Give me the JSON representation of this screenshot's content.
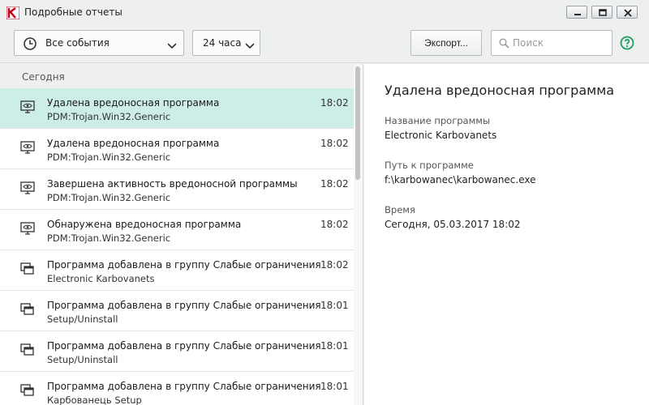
{
  "window": {
    "title": "Подробные отчеты",
    "accent_color": "#c4001a"
  },
  "toolbar": {
    "event_filter": "Все события",
    "period_filter": "24 часа",
    "export_label": "Экспорт...",
    "search_placeholder": "Поиск",
    "help_color": "#1f9e62"
  },
  "group": {
    "label": "Сегодня"
  },
  "events": [
    {
      "icon": "monitor-eye-icon",
      "title": "Удалена вредоносная программа",
      "subtitle": "PDM:Trojan.Win32.Generic",
      "time": "18:02",
      "selected": true
    },
    {
      "icon": "monitor-eye-icon",
      "title": "Удалена вредоносная программа",
      "subtitle": "PDM:Trojan.Win32.Generic",
      "time": "18:02"
    },
    {
      "icon": "monitor-eye-icon",
      "title": "Завершена активность вредоносной программы",
      "subtitle": "PDM:Trojan.Win32.Generic",
      "time": "18:02"
    },
    {
      "icon": "monitor-eye-icon",
      "title": "Обнаружена вредоносная программа",
      "subtitle": "PDM:Trojan.Win32.Generic",
      "time": "18:02"
    },
    {
      "icon": "app-windows-icon",
      "title": "Программа добавлена в группу Слабые ограничения",
      "subtitle": "Electronic Karbovanets",
      "time": "18:02"
    },
    {
      "icon": "app-windows-icon",
      "title": "Программа добавлена в группу Слабые ограничения",
      "subtitle": "Setup/Uninstall",
      "time": "18:01"
    },
    {
      "icon": "app-windows-icon",
      "title": "Программа добавлена в группу Слабые ограничения",
      "subtitle": "Setup/Uninstall",
      "time": "18:01"
    },
    {
      "icon": "app-windows-icon",
      "title": "Программа добавлена в группу Слабые ограничения",
      "subtitle": "Карбованець Setup",
      "time": "18:01"
    }
  ],
  "details": {
    "title": "Удалена вредоносная программа",
    "fields": [
      {
        "label": "Название программы",
        "value": "Electronic Karbovanets"
      },
      {
        "label": "Путь к программе",
        "value": "f:\\karbowanec\\karbowanec.exe"
      },
      {
        "label": "Время",
        "value": "Сегодня, 05.03.2017 18:02"
      }
    ]
  },
  "colors": {
    "selected_row": "#cdeee6",
    "pane_background": "#eef0f0"
  }
}
